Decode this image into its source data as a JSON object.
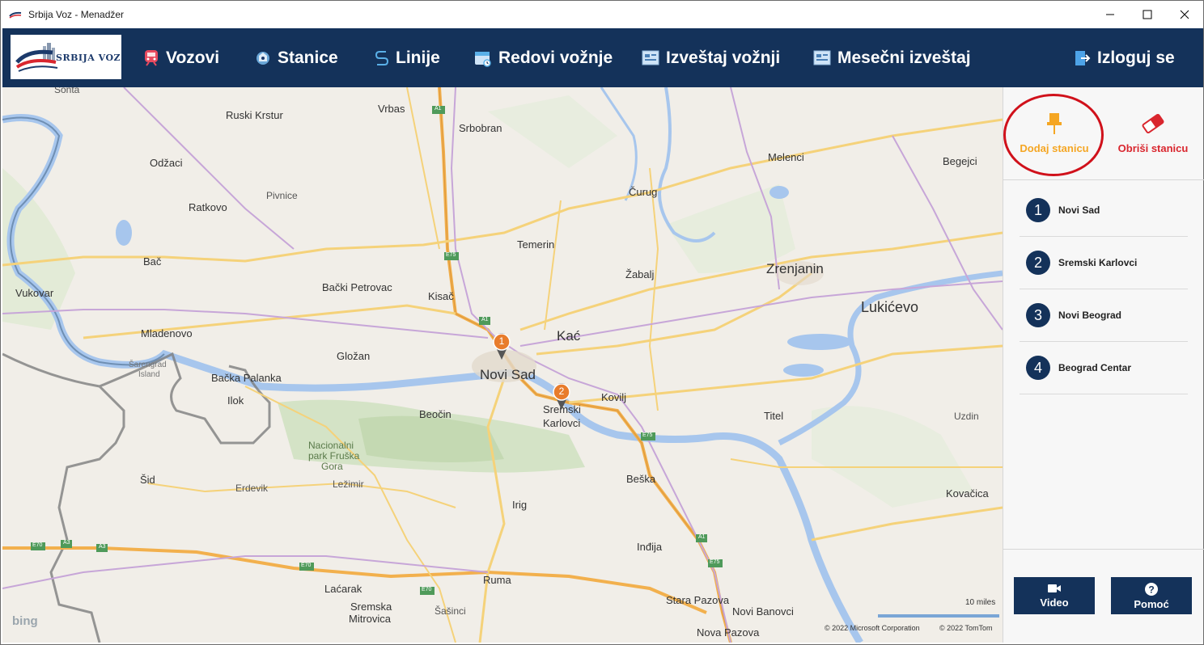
{
  "window": {
    "title": "Srbija Voz - Menadžer"
  },
  "logo": {
    "text": "SRBIJA VOZ"
  },
  "nav": {
    "items": [
      {
        "label": "Vozovi",
        "icon": "train-icon"
      },
      {
        "label": "Stanice",
        "icon": "station-icon"
      },
      {
        "label": "Linije",
        "icon": "route-icon"
      },
      {
        "label": "Redovi vožnje",
        "icon": "calendar-icon"
      },
      {
        "label": "Izveštaj vožnji",
        "icon": "report-icon"
      },
      {
        "label": "Mesečni izveštaj",
        "icon": "monthly-report-icon"
      }
    ],
    "logout": {
      "label": "Izloguj se",
      "icon": "logout-icon"
    }
  },
  "map": {
    "labels": {
      "sonta": "Sonta",
      "vrbas": "Vrbas",
      "ruski_krstur": "Ruski Krstur",
      "srbobran": "Srbobran",
      "odzaci": "Odžaci",
      "melenci": "Melenci",
      "begejci": "Begejci",
      "pivnice": "Pivnice",
      "ratkovo": "Ratkovo",
      "curug": "Čurug",
      "temerin": "Temerin",
      "bac": "Bač",
      "zabalj": "Žabalj",
      "zrenjanin": "Zrenjanin",
      "vukovar": "Vukovar",
      "backi_petrovac": "Bački Petrovac",
      "kisac": "Kisač",
      "lukicevo": "Lukićevo",
      "mladenovo": "Mladenovo",
      "kac": "Kać",
      "glozan": "Gložan",
      "novi_sad": "Novi Sad",
      "sarengrad": "Šarengrad",
      "island": "Island",
      "backa_palanka": "Bačka Palanka",
      "ilok": "Ilok",
      "kovilj": "Kovilj",
      "beocin": "Beočin",
      "sremski": "Sremski",
      "karlovci": "Karlovci",
      "titel": "Titel",
      "uzdin": "Uzdin",
      "nacionalni": "Nacionalni",
      "park_fruska": "park Fruška",
      "gora": "Gora",
      "sid": "Šid",
      "erdevik": "Erdevik",
      "lezimir": "Ležimir",
      "beska": "Beška",
      "kovacica": "Kovačica",
      "irig": "Irig",
      "indjija": "Inđija",
      "lacarak": "Laćarak",
      "ruma": "Ruma",
      "stara_pazova": "Stara Pazova",
      "sremska": "Sremska",
      "mitrovica": "Mitrovica",
      "sasinci": "Šašinci",
      "novi_banovci": "Novi Banovci",
      "nova_pazova": "Nova Pazova"
    },
    "road_shields": {
      "a1": "A1",
      "e75": "E75",
      "e70": "E70",
      "a3": "A3"
    },
    "scale": "10 miles",
    "copyright_ms": "© 2022 Microsoft Corporation",
    "copyright_tt": "© 2022 TomTom",
    "provider": "bing",
    "pins": [
      {
        "number": "1"
      },
      {
        "number": "2"
      }
    ]
  },
  "panel": {
    "add_station": "Dodaj stanicu",
    "remove_station": "Obriši stanicu",
    "stations": [
      {
        "number": "1",
        "name": "Novi Sad"
      },
      {
        "number": "2",
        "name": "Sremski Karlovci"
      },
      {
        "number": "3",
        "name": "Novi Beograd"
      },
      {
        "number": "4",
        "name": "Beograd Centar"
      }
    ],
    "video": "Video",
    "help": "Pomoć"
  },
  "colors": {
    "navbar": "#14325a",
    "add_accent": "#f5a623",
    "remove_accent": "#d9262e",
    "highlight_ring": "#d0111b",
    "river": "#a7c6ed",
    "highway": "#f2b04d"
  }
}
